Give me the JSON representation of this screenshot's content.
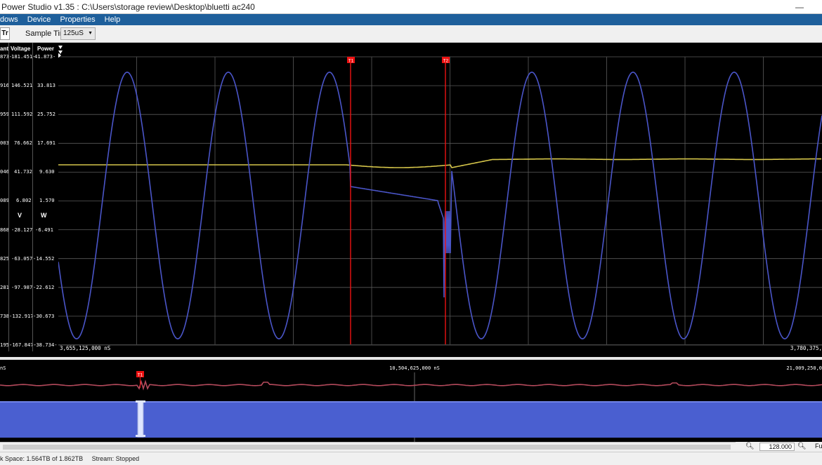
{
  "window": {
    "title": "Power Studio v1.35 : C:\\Users\\storage review\\Desktop\\bluetti ac240",
    "minimize": "—"
  },
  "menu": {
    "items": [
      "dows",
      "Device",
      "Properties",
      "Help"
    ]
  },
  "toolbar": {
    "tt_label": "Tr",
    "sample_label": "Sample Time:",
    "sample_value": "125uS"
  },
  "axes": {
    "current": {
      "header": "ant",
      "ticks": [
        "873-",
        "916",
        "959",
        "003",
        "046",
        "089",
        "868",
        "825",
        "281",
        "738",
        "195-"
      ]
    },
    "voltage": {
      "header": "Voltage",
      "unit": "V",
      "ticks": [
        "181.451-",
        "146.521",
        "111.592",
        "76.662",
        "41.732",
        "6.802",
        "-28.127",
        "-63.057",
        "-97.987",
        "-132.917",
        "-167.847-"
      ]
    },
    "power": {
      "header": "Power",
      "unit": "W",
      "ticks": [
        "41.873-",
        "33.813",
        "25.752",
        "17.691",
        "9.630",
        "1.570",
        "-6.491",
        "-14.552",
        "-22.612",
        "-30.673",
        "-38.734-"
      ]
    }
  },
  "main_plot": {
    "x_start": "3,655,125,000 nS",
    "x_end": "3,780,375,",
    "marker1": "T1",
    "marker2": "T2",
    "trace_colors": {
      "voltage": "#4a55c8",
      "power": "#d6c64a",
      "marker": "#ee1111"
    }
  },
  "overview": {
    "x_left": "nS",
    "x_mid": "10,504,625,000 nS",
    "x_right": "21,009,250,0",
    "marker": "T1"
  },
  "zoom": {
    "value": "128.000",
    "full_label": "Fu"
  },
  "status": {
    "disk": "k Space: 1.564TB of 1.862TB",
    "stream": "Stream:  Stopped"
  }
}
